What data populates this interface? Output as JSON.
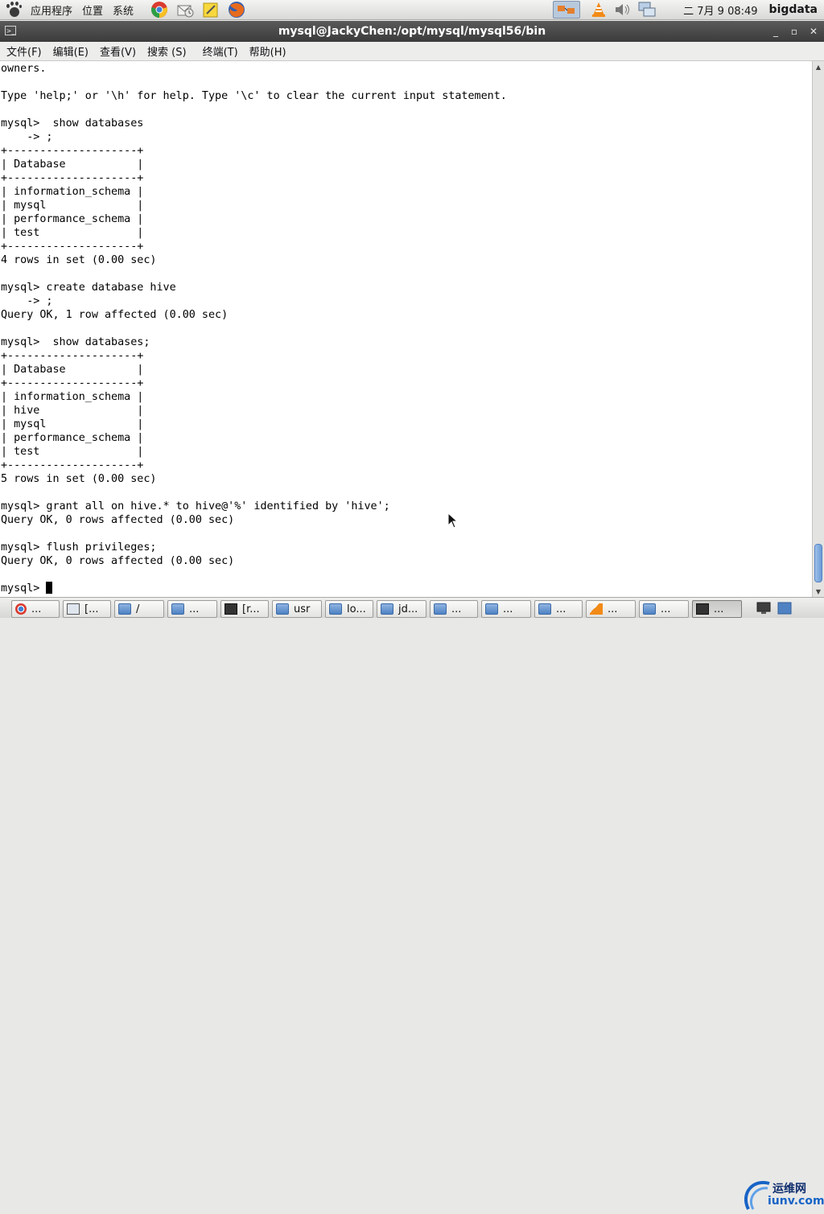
{
  "top_panel": {
    "menus": [
      "应用程序",
      "位置",
      "系统"
    ],
    "launchers": [
      "chrome-icon",
      "mail-icon",
      "notes-icon",
      "firefox-icon"
    ],
    "tray": [
      "network-icon",
      "vlc-icon",
      "volume-icon",
      "monitor-icon"
    ],
    "clock": "二 7月  9 08:49",
    "user": "bigdata"
  },
  "window": {
    "title": "mysql@JackyChen:/opt/mysql/mysql56/bin",
    "controls": [
      "minimize-icon",
      "maximize-icon",
      "close-icon"
    ]
  },
  "menubar": {
    "items": [
      "文件(F)",
      "编辑(E)",
      "查看(V)",
      "搜索 (S)",
      "终端(T)",
      "帮助(H)"
    ]
  },
  "terminal": {
    "prompt": "mysql> ",
    "lines": [
      "owners.",
      "",
      "Type 'help;' or '\\h' for help. Type '\\c' to clear the current input statement.",
      "",
      "mysql>  show databases",
      "    -> ;",
      "+--------------------+",
      "| Database           |",
      "+--------------------+",
      "| information_schema |",
      "| mysql              |",
      "| performance_schema |",
      "| test               |",
      "+--------------------+",
      "4 rows in set (0.00 sec)",
      "",
      "mysql> create database hive",
      "    -> ;",
      "Query OK, 1 row affected (0.00 sec)",
      "",
      "mysql>  show databases;",
      "+--------------------+",
      "| Database           |",
      "+--------------------+",
      "| information_schema |",
      "| hive               |",
      "| mysql              |",
      "| performance_schema |",
      "| test               |",
      "+--------------------+",
      "5 rows in set (0.00 sec)",
      "",
      "mysql> grant all on hive.* to hive@'%' identified by 'hive';",
      "Query OK, 0 rows affected (0.00 sec)",
      "",
      "mysql> flush privileges;",
      "Query OK, 0 rows affected (0.00 sec)",
      ""
    ]
  },
  "taskbar": {
    "items": [
      {
        "label": "...",
        "icon": "chrome-icon"
      },
      {
        "label": "[...",
        "icon": "computer-icon"
      },
      {
        "label": "/",
        "icon": "folder-icon"
      },
      {
        "label": "...",
        "icon": "folder-icon"
      },
      {
        "label": "[r...",
        "icon": "terminal-icon"
      },
      {
        "label": "usr",
        "icon": "folder-icon"
      },
      {
        "label": "lo...",
        "icon": "folder-icon"
      },
      {
        "label": "jd...",
        "icon": "folder-icon"
      },
      {
        "label": "...",
        "icon": "folder-icon"
      },
      {
        "label": "...",
        "icon": "folder-icon"
      },
      {
        "label": "...",
        "icon": "folder-icon"
      },
      {
        "label": "...",
        "icon": "vlc-icon"
      },
      {
        "label": "...",
        "icon": "folder-icon"
      },
      {
        "label": "...",
        "icon": "terminal-icon"
      }
    ],
    "system_icons": [
      "show-desktop-icon",
      "workspace-icon"
    ]
  },
  "watermark": {
    "label": "运维网",
    "url": "iunv.com"
  },
  "colors": {
    "titlebar": "#3b3b3b",
    "terminal_bg": "#ffffff",
    "terminal_fg": "#000000",
    "scroll_thumb": "#6d9bd6"
  }
}
